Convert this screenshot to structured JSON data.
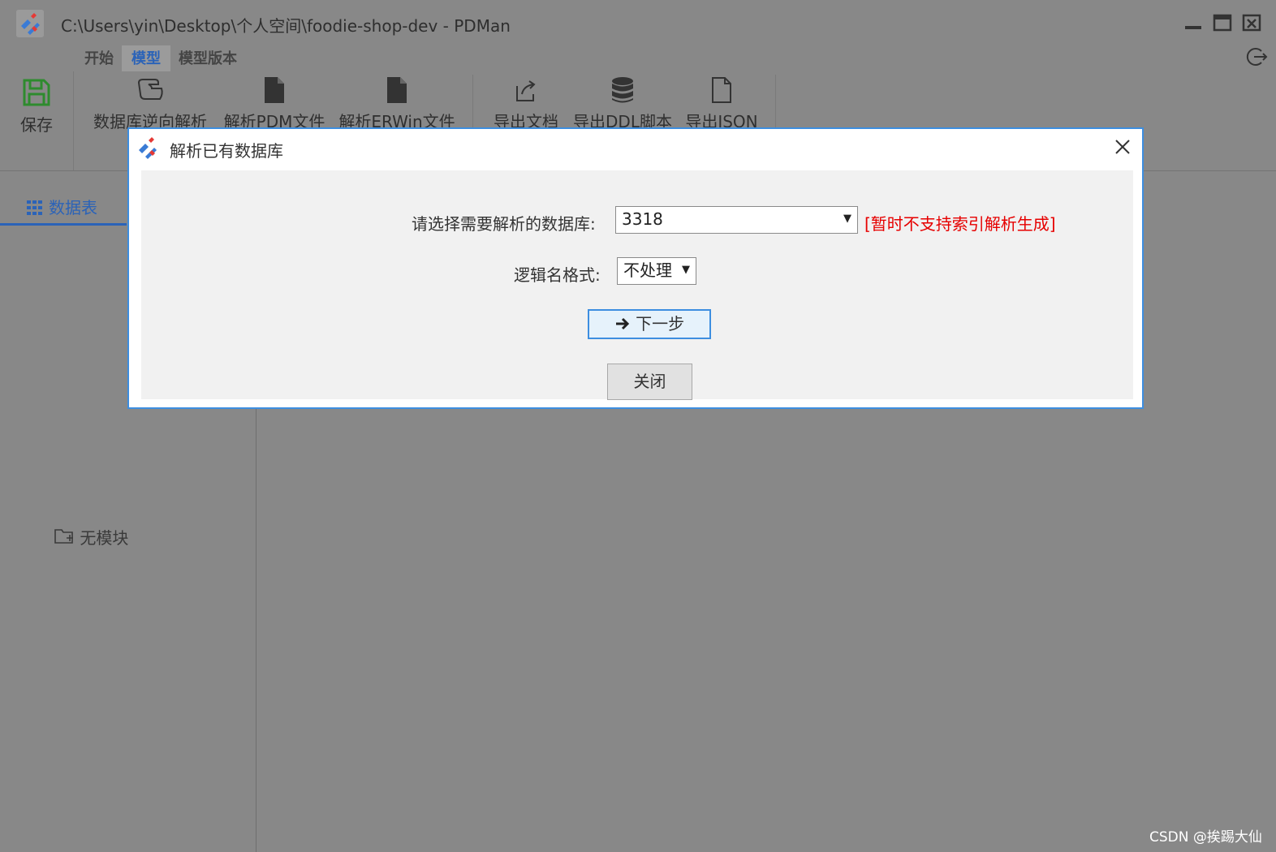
{
  "window": {
    "title": "C:\\Users\\yin\\Desktop\\个人空间\\foodie-shop-dev - PDMan",
    "icons": [
      "app-logo-icon",
      "minimize-icon",
      "maximize-icon",
      "close-icon",
      "logout-icon"
    ]
  },
  "ribbon": {
    "tabs": [
      "开始",
      "模型",
      "模型版本"
    ],
    "active_tab": "模型",
    "save_label": "保存",
    "buttons": [
      "数据库逆向解析",
      "解析PDM文件",
      "解析ERWin文件",
      "导出文档",
      "导出DDL脚本",
      "导出JSON"
    ]
  },
  "left_panel": {
    "tab_label": "数据表",
    "empty_text": "无模块"
  },
  "dialog": {
    "title": "解析已有数据库",
    "db_label": "请选择需要解析的数据库:",
    "db_value": "3318",
    "warning": "[暂时不支持索引解析生成]",
    "format_label": "逻辑名格式:",
    "format_value": "不处理",
    "next_button": "下一步",
    "close_button": "关闭"
  },
  "colors": {
    "accent": "#2b63b8",
    "dialog_border": "#3d8ee0",
    "warning": "#e60000",
    "overlay": "#888888"
  },
  "watermark": "CSDN @挨踢大仙"
}
